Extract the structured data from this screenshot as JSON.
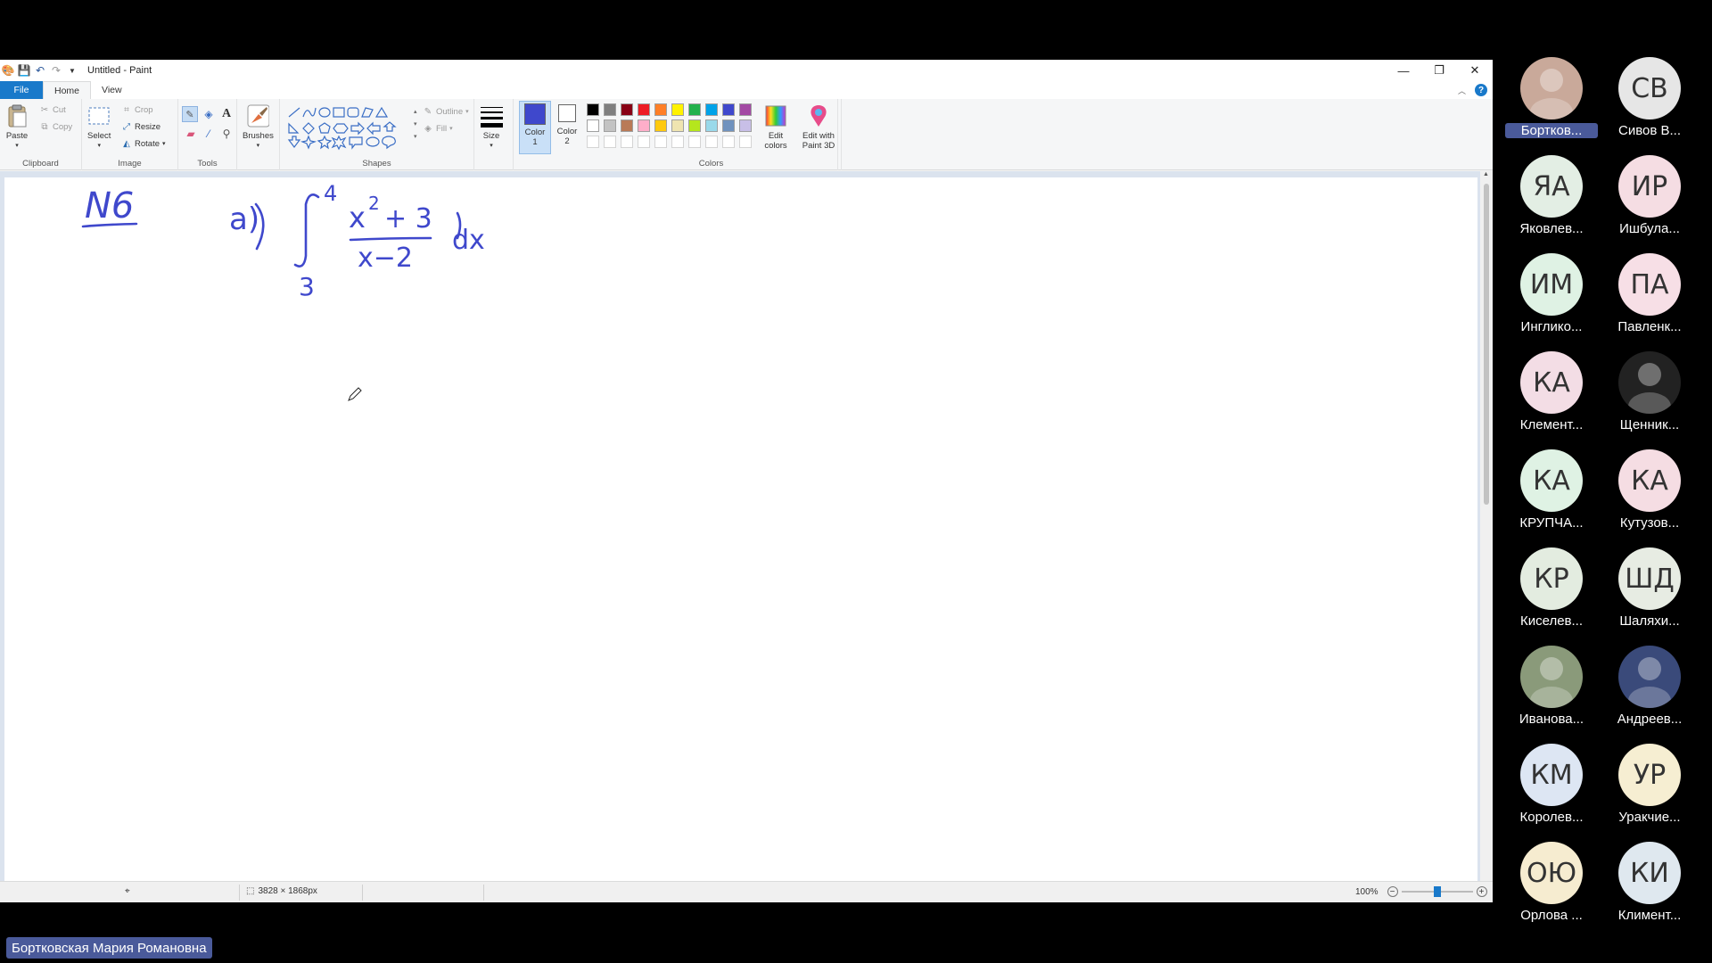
{
  "window": {
    "title": "Untitled - Paint",
    "controls": [
      "—",
      "❐",
      "✕"
    ]
  },
  "tabs": [
    "File",
    "Home",
    "View"
  ],
  "ribbon": {
    "clipboard": {
      "label": "Clipboard",
      "paste": "Paste",
      "cut": "Cut",
      "copy": "Copy"
    },
    "image": {
      "label": "Image",
      "select": "Select",
      "crop": "Crop",
      "resize": "Resize",
      "rotate": "Rotate"
    },
    "tools": {
      "label": "Tools"
    },
    "brushes": {
      "label": "Brushes"
    },
    "shapes": {
      "label": "Shapes",
      "outline": "Outline",
      "fill": "Fill"
    },
    "size": {
      "label": "Size"
    },
    "color1": {
      "label": "Color 1",
      "value": "#3f48cc"
    },
    "color2": {
      "label": "Color 2",
      "value": "#ffffff"
    },
    "colors": {
      "label": "Colors",
      "row1": [
        "#000000",
        "#7f7f7f",
        "#880015",
        "#ed1c24",
        "#ff7f27",
        "#fff200",
        "#22b14c",
        "#00a2e8",
        "#3f48cc",
        "#a349a4"
      ],
      "row2": [
        "#ffffff",
        "#c3c3c3",
        "#b97a57",
        "#ffaec9",
        "#ffc90e",
        "#efe4b0",
        "#b5e61d",
        "#99d9ea",
        "#7092be",
        "#c8bfe7"
      ]
    },
    "edit_colors": "Edit colors",
    "edit_paint3d": "Edit with Paint 3D"
  },
  "status": {
    "dimensions": "3828 × 1868px",
    "zoom": "100%",
    "zoom_minus": "−",
    "zoom_plus": "+"
  },
  "canvas_text": {
    "number": "N6",
    "part": "a)",
    "upper": "4",
    "lower": "3",
    "numerator": "x",
    "exp": "2",
    "plus3": "+ 3",
    "denominator": "x−2",
    "dx": "dx"
  },
  "participants": [
    {
      "initials": "",
      "name": "Бортков...",
      "color": "#c9a99a",
      "photo": true,
      "highlight": true
    },
    {
      "initials": "СВ",
      "name": "Сивов В...",
      "color": "#e6e6e6"
    },
    {
      "initials": "ЯА",
      "name": "Яковлев...",
      "color": "#e3eee4"
    },
    {
      "initials": "ИР",
      "name": "Ишбула...",
      "color": "#f5dde3"
    },
    {
      "initials": "ИМ",
      "name": "Инглико...",
      "color": "#dff2e4"
    },
    {
      "initials": "ПА",
      "name": "Павленк...",
      "color": "#f7dfe6"
    },
    {
      "initials": "КА",
      "name": "Клемент...",
      "color": "#f3dde5"
    },
    {
      "initials": "",
      "name": "Щенник...",
      "color": "#222222",
      "photo": true
    },
    {
      "initials": "КА",
      "name": "КРУПЧА...",
      "color": "#dff2e4"
    },
    {
      "initials": "КА",
      "name": "Кутузов...",
      "color": "#f5dde3"
    },
    {
      "initials": "КР",
      "name": "Киселев...",
      "color": "#e3ece0"
    },
    {
      "initials": "ШД",
      "name": "Шаляхи...",
      "color": "#e7ece3"
    },
    {
      "initials": "",
      "name": "Иванова...",
      "color": "#8a9a7a",
      "photo": true
    },
    {
      "initials": "",
      "name": "Андреев...",
      "color": "#3a4a7a",
      "photo": true
    },
    {
      "initials": "КМ",
      "name": "Королев...",
      "color": "#dde6f3"
    },
    {
      "initials": "УР",
      "name": "Уракчие...",
      "color": "#f6eed2"
    },
    {
      "initials": "ОЮ",
      "name": "Орлова ...",
      "color": "#f6ecd0"
    },
    {
      "initials": "КИ",
      "name": "Климент...",
      "color": "#dfe8ef"
    }
  ],
  "presenter": "Бортковская Мария Романовна"
}
